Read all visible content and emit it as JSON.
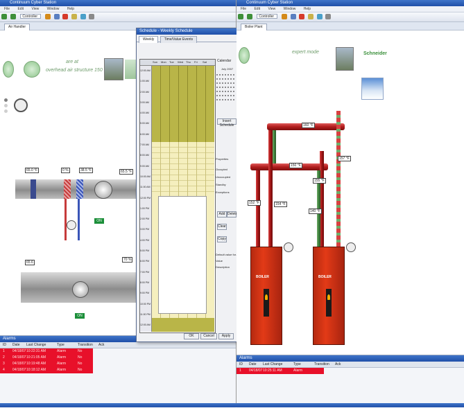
{
  "left_window": {
    "title": "Continuum Cyber Station",
    "menu": [
      "File",
      "Edit",
      "View",
      "Window",
      "Help"
    ],
    "address": "Controller",
    "tab": "Air Handler",
    "banner_text": [
      "are at",
      "overhead air structure 150"
    ],
    "sensor_labels": [
      "65.0 °F",
      "0 %",
      "38.5 °F",
      "65.5 °F",
      "70 %"
    ],
    "fan_status": "ON",
    "fan_status_2": "ON",
    "lower_label": "65.6",
    "alarm_pane": {
      "title": "Alarms",
      "columns": [
        "ID",
        "Date",
        "Last Change",
        "Type",
        "Transition",
        "Ack"
      ],
      "rows": [
        [
          "1",
          "04/18/07",
          "10:22:31 AM",
          "Alarm",
          "04/18/07",
          "No"
        ],
        [
          "2",
          "04/18/07",
          "10:21:05 AM",
          "Alarm",
          "04/18/07",
          "No"
        ],
        [
          "3",
          "04/18/07",
          "10:19:48 AM",
          "Alarm",
          "04/18/07",
          "No"
        ],
        [
          "4",
          "04/18/07",
          "10:18:12 AM",
          "Alarm",
          "04/18/07",
          "No"
        ]
      ]
    }
  },
  "schedule_window": {
    "title": "Schedule - Weekly Schedule",
    "tabs": [
      "Weekly",
      "Time/Value Events"
    ],
    "days": [
      "Sun",
      "Mon",
      "Tue",
      "Wed",
      "Thu",
      "Fri",
      "Sat"
    ],
    "times": [
      "12:00 AM",
      "1:00 AM",
      "2:00 AM",
      "3:00 AM",
      "4:00 AM",
      "5:00 AM",
      "6:00 AM",
      "7:00 AM",
      "8:00 AM",
      "9:00 AM",
      "10:00 AM",
      "11:00 AM",
      "12:00 PM",
      "1:00 PM",
      "2:00 PM",
      "3:00 PM",
      "4:00 PM",
      "5:00 PM",
      "6:00 PM",
      "7:00 PM",
      "8:00 PM",
      "9:00 PM",
      "10:00 PM",
      "11:00 PM",
      "12:00 AM"
    ],
    "calendar_title": "Calendar",
    "month": "July 2007",
    "side_labels": [
      "Properties",
      "Occupied",
      "Unoccupied",
      "Standby",
      "Exceptions",
      "Edit",
      "Remove"
    ],
    "side_buttons": [
      "Insert Schedule",
      "Add",
      "Delete",
      "Clear",
      "Copy"
    ],
    "footer_buttons": [
      "OK",
      "Cancel",
      "Apply"
    ],
    "field_labels": [
      "Default value for...",
      "Value",
      "Description"
    ]
  },
  "right_window": {
    "title": "Continuum Cyber Station",
    "menu": [
      "File",
      "Edit",
      "View",
      "Window",
      "Help"
    ],
    "address": "Controller",
    "tab": "Boiler Plant",
    "header_text": "expert mode",
    "brand_text": "Schneider",
    "pipe_labels": [
      "160 °F",
      "150 °F",
      "157 °F",
      "155 °F",
      "152 °F",
      "154 °F",
      "140 °F"
    ],
    "boiler_label": "BOILER",
    "alarm_pane": {
      "title": "Alarms",
      "columns": [
        "ID",
        "Date",
        "Last Change",
        "Type",
        "Transition",
        "Ack"
      ],
      "rows": [
        [
          "1",
          "04/18/07",
          "10:25:11 AM",
          "Alarm",
          "04/18/07",
          "No"
        ]
      ]
    }
  },
  "colors": {
    "titlebar": "#1f4fa8",
    "alarm_red": "#e8102a",
    "boiler_red": "#e23a17",
    "schedule_olive": "#b9b548",
    "schedule_cream": "#f5efbe",
    "pipe_red": "#b11d1d",
    "pipe_green": "#3f7f3b"
  }
}
